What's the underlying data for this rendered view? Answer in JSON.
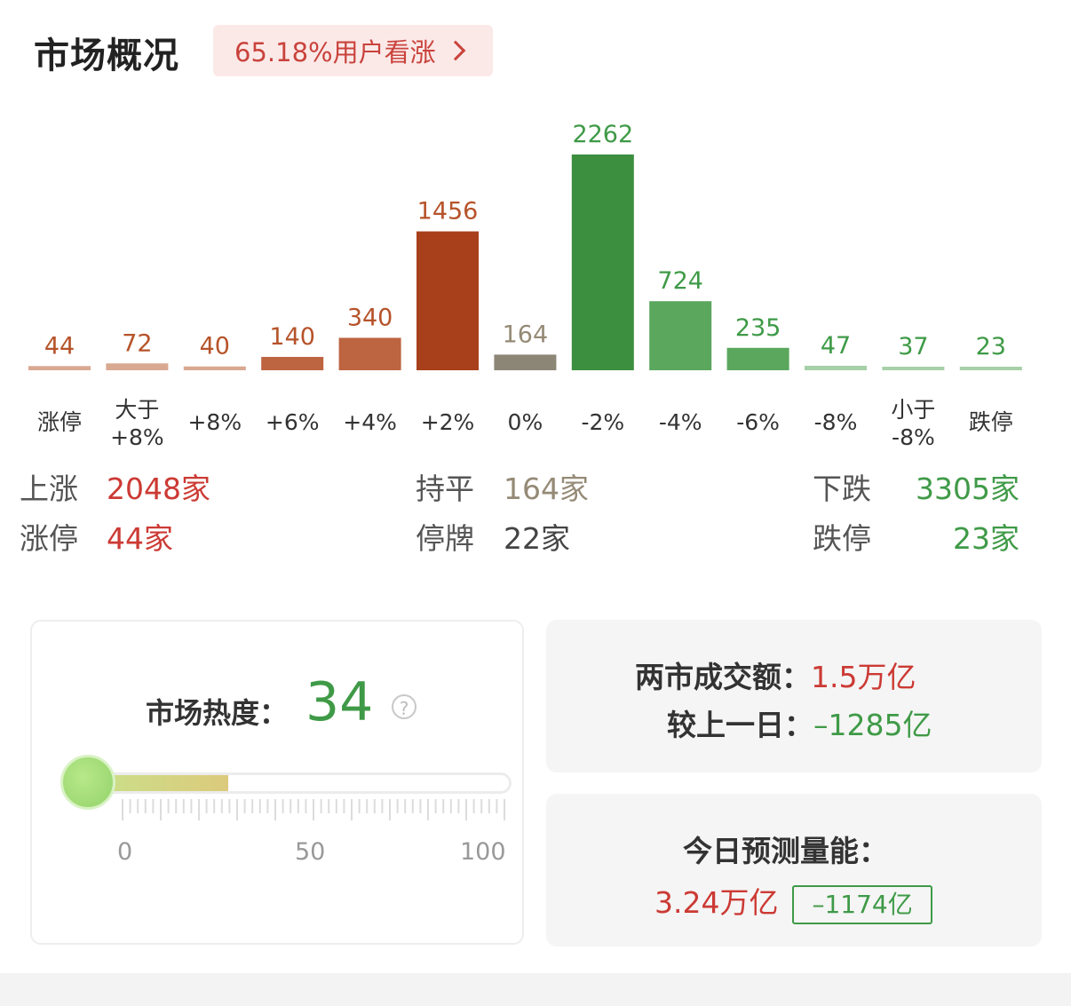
{
  "header": {
    "title": "市场概况",
    "sentiment": "65.18%用户看涨"
  },
  "colors": {
    "up_strong": "#a8401c",
    "up_mid": "#bd6440",
    "up_light": "#d9a891",
    "flat": "#8c8677",
    "down_strong": "#3c8f3f",
    "down_mid": "#5aa75d",
    "down_light": "#a6d0a8",
    "label_up": "#b6532a",
    "label_flat": "#958a76",
    "label_down": "#3f9a47"
  },
  "chart_data": {
    "type": "bar",
    "categories": [
      "涨停",
      "大于\n+8%",
      "+8%",
      "+6%",
      "+4%",
      "+2%",
      "0%",
      "-2%",
      "-4%",
      "-6%",
      "-8%",
      "小于\n-8%",
      "跌停"
    ],
    "values": [
      44,
      72,
      40,
      140,
      340,
      1456,
      164,
      2262,
      724,
      235,
      47,
      37,
      23
    ],
    "value_labels": [
      "44",
      "72",
      "40",
      "140",
      "340",
      "1456",
      "164",
      "2262",
      "724",
      "235",
      "47",
      "37",
      "23"
    ]
  },
  "stats": {
    "up_label": "上涨",
    "up_value": "2048家",
    "flat_label": "持平",
    "flat_value": "164家",
    "down_label": "下跌",
    "down_value": "3305家",
    "limit_up_label": "涨停",
    "limit_up_value": "44家",
    "suspended_label": "停牌",
    "suspended_value": "22家",
    "limit_down_label": "跌停",
    "limit_down_value": "23家"
  },
  "heat": {
    "label": "市场热度：",
    "value": "34",
    "level": 34,
    "scale": [
      "0",
      "50",
      "100"
    ]
  },
  "turnover": {
    "label": "两市成交额：",
    "value": "1.5万亿",
    "compare_label": "较上一日：",
    "compare_value": "–1285亿"
  },
  "forecast": {
    "label": "今日预测量能：",
    "value": "3.24万亿",
    "change": "–1174亿"
  }
}
